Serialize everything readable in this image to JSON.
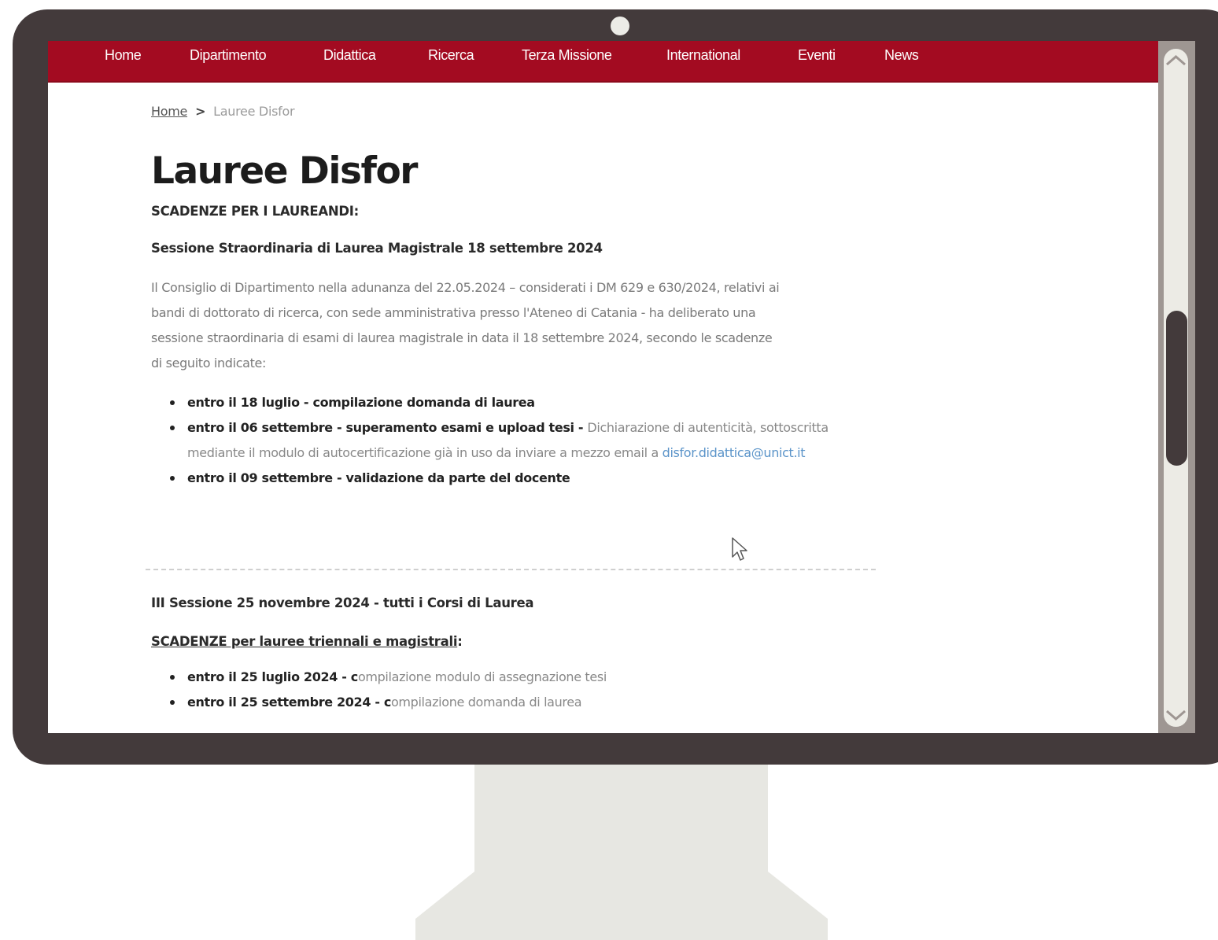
{
  "nav": {
    "items": [
      "Home",
      "Dipartimento",
      "Didattica",
      "Ricerca",
      "Terza Missione",
      "International",
      "Eventi",
      "News"
    ]
  },
  "breadcrumb": {
    "home": "Home",
    "separator": ">",
    "current": "Lauree Disfor"
  },
  "page": {
    "title": "Lauree Disfor",
    "deadlines_heading": "SCADENZE PER I LAUREANDI:",
    "session1_heading": "Sessione Straordinaria di Laurea Magistrale 18 settembre 2024",
    "paragraph": "Il Consiglio di Dipartimento  nella  adunanza del 22.05.2024 – considerati i DM 629 e 630/2024, relativi ai bandi di dottorato di ricerca, con sede amministrativa presso l'Ateneo di Catania -  ha deliberato  una sessione straordinaria di esami di laurea magistrale in data  il 18 settembre 2024, secondo le  scadenze di seguito indicate:",
    "list1": [
      {
        "bold": "entro il 18 luglio - compilazione domanda di laurea"
      },
      {
        "bold": "entro il 06 settembre - superamento esami e upload tesi - ",
        "text": "Dichiarazione di autenticità, sottoscritta mediante il modulo di autocertificazione già in uso da inviare a mezzo email a ",
        "link": "disfor.didattica@unict.it"
      },
      {
        "bold": "entro il 09 settembre - validazione da parte del docente"
      }
    ],
    "session3_heading": "III Sessione 25 novembre 2024 - tutti i Corsi di Laurea",
    "scadenze2_heading": "SCADENZE per lauree triennali e magistrali",
    "scadenze2_colon": ":",
    "list2": [
      {
        "bold": "entro il 25 luglio 2024 - c",
        "text": "ompilazione modulo di assegnazione tesi"
      },
      {
        "bold": "entro il 25 settembre 2024 - c",
        "text": "ompilazione domanda di laurea"
      }
    ]
  },
  "icons": {
    "scroll_up": "chevron-up-icon",
    "scroll_down": "chevron-down-icon",
    "cursor": "mouse-pointer-icon"
  },
  "colors": {
    "nav_background": "#a30b21",
    "bezel": "#433a3b",
    "stand": "#e7e7e2",
    "link": "#5b94c9"
  }
}
